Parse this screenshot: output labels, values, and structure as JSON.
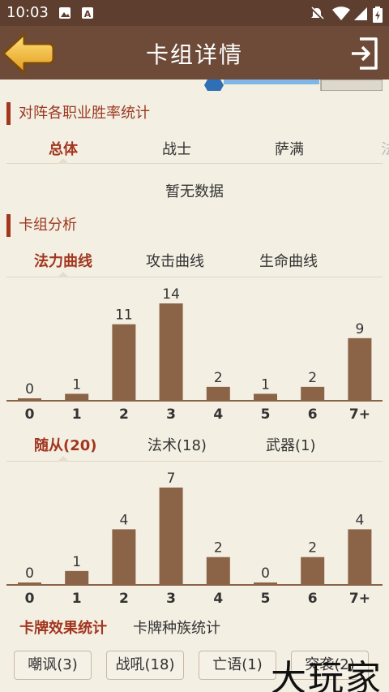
{
  "status": {
    "time": "10:03"
  },
  "header": {
    "title": "卡组详情"
  },
  "winrate": {
    "title": "对阵各职业胜率统计",
    "tabs": [
      "总体",
      "战士",
      "萨满",
      "法"
    ],
    "no_data": "暂无数据"
  },
  "analysis": {
    "title": "卡组分析",
    "curve_tabs": [
      "法力曲线",
      "攻击曲线",
      "生命曲线"
    ],
    "type_tabs": [
      "随从(20)",
      "法术(18)",
      "武器(1)"
    ],
    "effect_tabs": [
      "卡牌效果统计",
      "卡牌种族统计"
    ],
    "effects": [
      "嘲讽(3)",
      "战吼(18)",
      "亡语(1)",
      "突袭(2)"
    ]
  },
  "watermark": "大玩家",
  "colors": {
    "bar": "#8b6347",
    "accent": "#a2361f",
    "header": "#6e4b38"
  },
  "chart_data": [
    {
      "type": "bar",
      "categories": [
        "0",
        "1",
        "2",
        "3",
        "4",
        "5",
        "6",
        "7+"
      ],
      "values": [
        0,
        1,
        11,
        14,
        2,
        1,
        2,
        9
      ],
      "ylim": [
        0,
        14
      ]
    },
    {
      "type": "bar",
      "categories": [
        "0",
        "1",
        "2",
        "3",
        "4",
        "5",
        "6",
        "7+"
      ],
      "values": [
        0,
        1,
        4,
        7,
        2,
        0,
        2,
        4
      ],
      "ylim": [
        0,
        7
      ]
    }
  ]
}
